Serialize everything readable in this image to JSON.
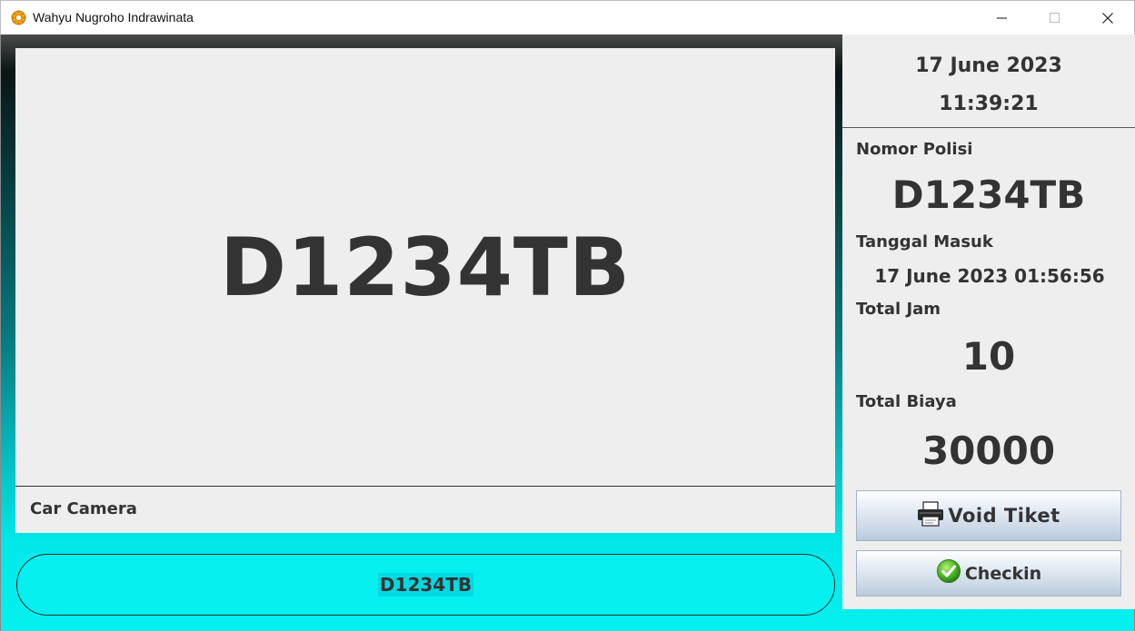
{
  "window": {
    "title": "Wahyu Nugroho Indrawinata",
    "icons": [
      "app-gear-icon",
      "minimize-icon",
      "maximize-icon",
      "close-icon"
    ]
  },
  "camera": {
    "plate": "D1234TB",
    "label": "Car Camera"
  },
  "plate_input": {
    "value": "D1234TB"
  },
  "datetime": {
    "date": "17 June 2023",
    "time": "11:39:21"
  },
  "details": {
    "nomor_polisi_label": "Nomor Polisi",
    "nomor_polisi_value": "D1234TB",
    "tanggal_masuk_label": "Tanggal  Masuk",
    "tanggal_masuk_value": "17 June 2023 01:56:56",
    "total_jam_label": "Total Jam",
    "total_jam_value": "10",
    "total_biaya_label": "Total Biaya",
    "total_biaya_value": "30000"
  },
  "buttons": {
    "void_label": "Void Tiket",
    "void_icon": "printer-icon",
    "checkin_label": "Checkin",
    "checkin_icon": "checkmark-icon"
  },
  "colors": {
    "accent_cyan": "#05f0ef",
    "text_dark": "#333333",
    "panel_bg": "#eeeeee"
  }
}
